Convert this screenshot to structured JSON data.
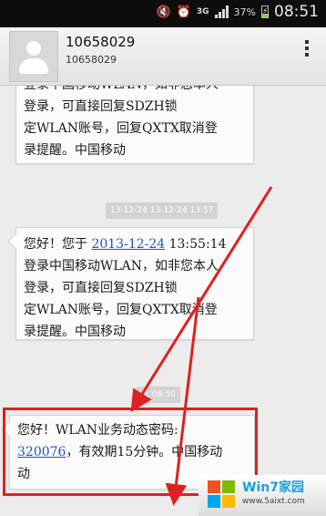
{
  "status_bar": {
    "network_type": "3G",
    "battery_percent": "37%",
    "battery_level": 0.37,
    "time": "08:51",
    "icons": [
      "mute-icon",
      "alarm-icon",
      "signal-icon",
      "battery-charging-icon"
    ]
  },
  "header": {
    "contact_name": "10658029",
    "contact_number": "10658029",
    "avatar_icon": "person-icon",
    "menu_icon": "overflow-menu-icon"
  },
  "messages": [
    {
      "text": "登录中国移动WLAN，如非您本人\n登录，可直接回复SDZH锁\n定WLAN账号，回复QXTX取消登\n录提醒。中国移动"
    },
    {
      "timestamp": "13-12-24 13-12-24 13:57",
      "prefix": "您好！您于 ",
      "link": "2013-12-24",
      "rest": " 13:55:14\n登录中国移动WLAN，如非您本人\n登录，可直接回复SDZH锁\n定WLAN账号，回复QXTX取消登\n录提醒。中国移动"
    },
    {
      "timestamp": "天 08:50",
      "line1": "您好！WLAN业务动态密码:",
      "link": "320076",
      "rest": "，有效期15分钟。中国移动\n动"
    }
  ],
  "watermark": {
    "title": "Win7家园",
    "url": "www.5aixt.com"
  },
  "colors": {
    "highlight": "#e02020",
    "link": "#1e55c8",
    "bubble": "#fbfbfb"
  }
}
